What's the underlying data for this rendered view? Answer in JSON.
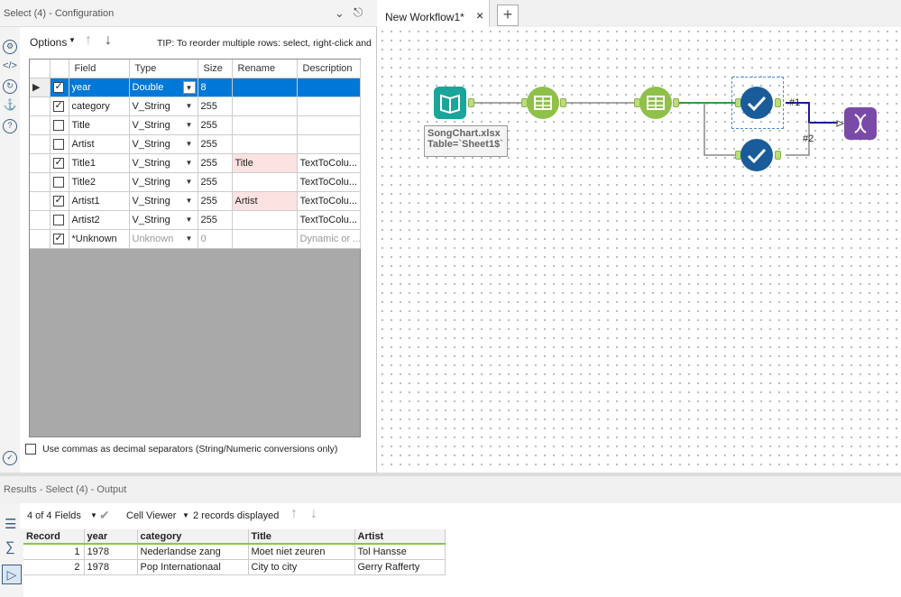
{
  "config": {
    "title": "Select (4) - Configuration",
    "options_label": "Options",
    "tip": "TIP: To reorder multiple rows: select, right-click and",
    "columns": [
      "Field",
      "Type",
      "Size",
      "Rename",
      "Description"
    ],
    "rows": [
      {
        "checked": true,
        "field": "year",
        "type": "Double",
        "size": "8",
        "rename": "",
        "description": ""
      },
      {
        "checked": true,
        "field": "category",
        "type": "V_String",
        "size": "255",
        "rename": "",
        "description": ""
      },
      {
        "checked": false,
        "field": "Title",
        "type": "V_String",
        "size": "255",
        "rename": "",
        "description": ""
      },
      {
        "checked": false,
        "field": "Artist",
        "type": "V_String",
        "size": "255",
        "rename": "",
        "description": ""
      },
      {
        "checked": true,
        "field": "Title1",
        "type": "V_String",
        "size": "255",
        "rename": "Title",
        "description": "TextToColu..."
      },
      {
        "checked": false,
        "field": "Title2",
        "type": "V_String",
        "size": "255",
        "rename": "",
        "description": "TextToColu..."
      },
      {
        "checked": true,
        "field": "Artist1",
        "type": "V_String",
        "size": "255",
        "rename": "Artist",
        "description": "TextToColu..."
      },
      {
        "checked": false,
        "field": "Artist2",
        "type": "V_String",
        "size": "255",
        "rename": "",
        "description": "TextToColu..."
      },
      {
        "checked": true,
        "field": "*Unknown",
        "type": "Unknown",
        "size": "0",
        "rename": "",
        "description": "Dynamic or ..."
      }
    ],
    "decimal_label": "Use commas as decimal separators (String/Numeric conversions only)"
  },
  "workflow": {
    "tab_label": "New Workflow1*",
    "input_annotation_line1": "SongChart.xlsx",
    "input_annotation_line2": "Table=`Sheet1$`",
    "output1_label": "#1",
    "output2_label": "#2"
  },
  "results": {
    "title": "Results - Select (4) - Output",
    "fields_label": "4 of 4 Fields",
    "viewer_label": "Cell Viewer",
    "records_label": "2 records displayed",
    "columns": [
      "Record",
      "year",
      "category",
      "Title",
      "Artist"
    ],
    "rows": [
      [
        "1",
        "1978",
        "Nederlandse zang",
        "Moet niet zeuren",
        "Tol Hansse"
      ],
      [
        "2",
        "1978",
        "Pop Internationaal",
        "City to city",
        "Gerry Rafferty"
      ]
    ]
  },
  "colors": {
    "selection": "#0078d7",
    "tool_green": "#8fc04a",
    "tool_blue": "#1a5c9a",
    "tool_purple": "#7a4aa8",
    "input_teal": "#1aa59a"
  }
}
